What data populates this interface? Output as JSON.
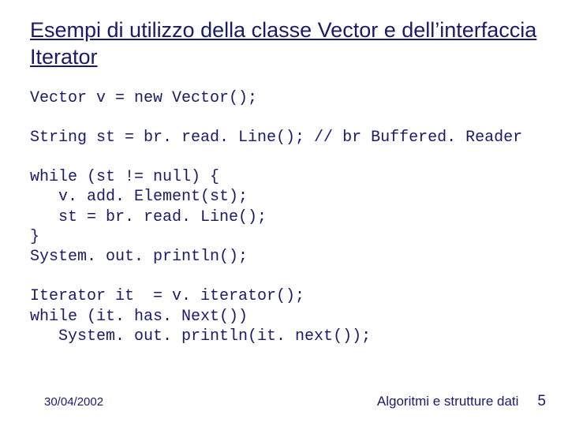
{
  "title": "Esempi di utilizzo della classe Vector e dell’interfaccia Iterator ",
  "code": "Vector v = new Vector();\n\nString st = br. read. Line(); // br Buffered. Reader\n\nwhile (st != null) {\n   v. add. Element(st);\n   st = br. read. Line();\n}\nSystem. out. println();\n\nIterator it  = v. iterator();\nwhile (it. has. Next())\n   System. out. println(it. next());",
  "footer": {
    "date": "30/04/2002",
    "caption": "Algoritmi e strutture dati",
    "page": "5"
  }
}
